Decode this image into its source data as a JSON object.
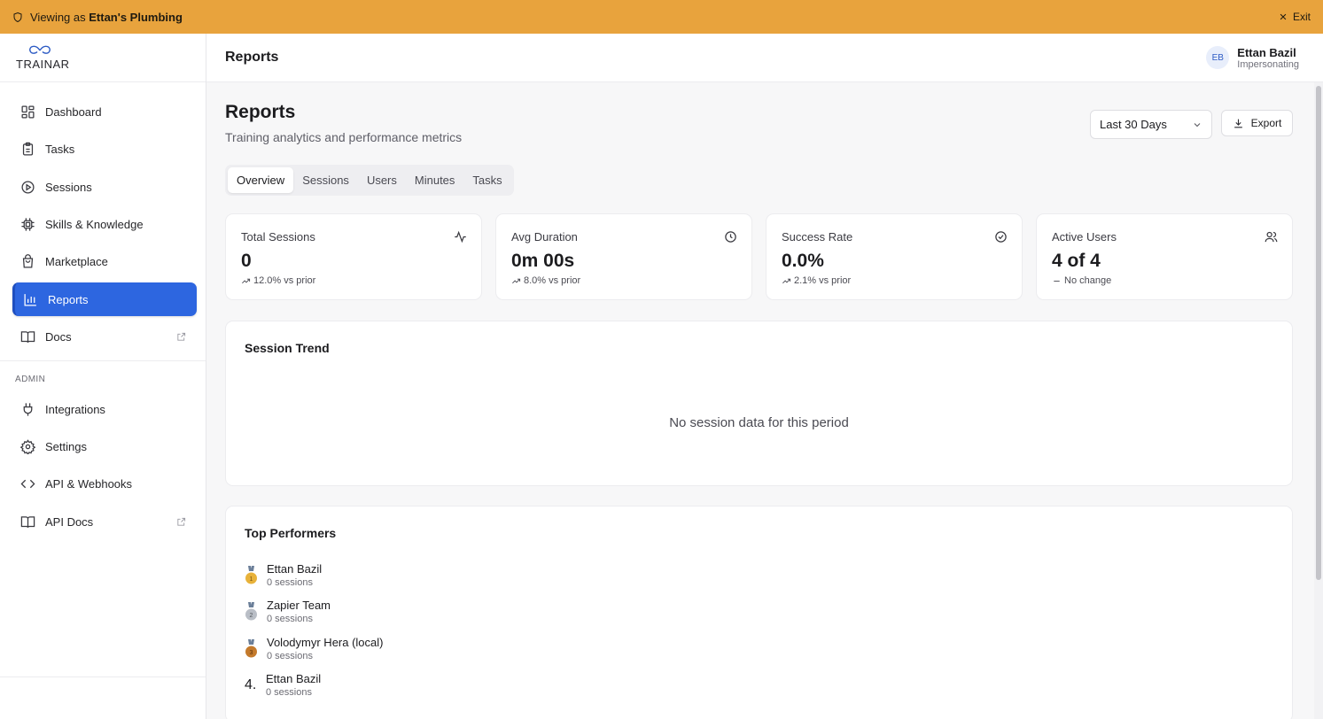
{
  "banner": {
    "prefix": "Viewing as ",
    "org": "Ettan's Plumbing",
    "exit_label": "Exit",
    "color": "#e8a33d"
  },
  "logo": {
    "text": "TRAINAR"
  },
  "sidebar": {
    "items": [
      {
        "label": "Dashboard",
        "icon": "dashboard-icon"
      },
      {
        "label": "Tasks",
        "icon": "clipboard-icon"
      },
      {
        "label": "Sessions",
        "icon": "play-circle-icon"
      },
      {
        "label": "Skills & Knowledge",
        "icon": "chip-icon"
      },
      {
        "label": "Marketplace",
        "icon": "shopping-bag-icon"
      },
      {
        "label": "Reports",
        "icon": "bar-chart-icon",
        "active": true
      },
      {
        "label": "Docs",
        "icon": "book-icon",
        "external": true
      }
    ],
    "admin_label": "ADMIN",
    "admin_items": [
      {
        "label": "Integrations",
        "icon": "plug-icon"
      },
      {
        "label": "Settings",
        "icon": "gear-icon"
      },
      {
        "label": "API & Webhooks",
        "icon": "code-icon"
      },
      {
        "label": "API Docs",
        "icon": "book-icon",
        "external": true
      }
    ],
    "active_color": "#2d66e0"
  },
  "header": {
    "title": "Reports",
    "user": {
      "initials": "EB",
      "name": "Ettan Bazil",
      "role": "Impersonating"
    }
  },
  "page": {
    "title": "Reports",
    "subtitle": "Training analytics and performance metrics",
    "date_range": "Last 30 Days",
    "export_label": "Export",
    "tabs": [
      {
        "label": "Overview",
        "active": true
      },
      {
        "label": "Sessions"
      },
      {
        "label": "Users"
      },
      {
        "label": "Minutes"
      },
      {
        "label": "Tasks"
      }
    ]
  },
  "stats": [
    {
      "label": "Total Sessions",
      "value": "0",
      "delta": "12.0% vs prior",
      "icon": "activity-icon",
      "trend": "up"
    },
    {
      "label": "Avg Duration",
      "value": "0m 00s",
      "delta": "8.0% vs prior",
      "icon": "clock-icon",
      "trend": "up"
    },
    {
      "label": "Success Rate",
      "value": "0.0%",
      "delta": "2.1% vs prior",
      "icon": "check-circle-icon",
      "trend": "up"
    },
    {
      "label": "Active Users",
      "value": "4 of 4",
      "delta": "No change",
      "icon": "users-icon",
      "trend": "flat"
    }
  ],
  "session_trend": {
    "title": "Session Trend",
    "empty_text": "No session data for this period"
  },
  "top_performers": {
    "title": "Top Performers",
    "rows": [
      {
        "rank_badge": "gold-medal-icon",
        "name": "Ettan Bazil",
        "sessions": "0 sessions"
      },
      {
        "rank_badge": "silver-medal-icon",
        "name": "Zapier Team",
        "sessions": "0 sessions"
      },
      {
        "rank_badge": "bronze-medal-icon",
        "name": "Volodymyr Hera (local)",
        "sessions": "0 sessions"
      },
      {
        "rank": "4.",
        "name": "Ettan Bazil",
        "sessions": "0 sessions"
      }
    ]
  }
}
